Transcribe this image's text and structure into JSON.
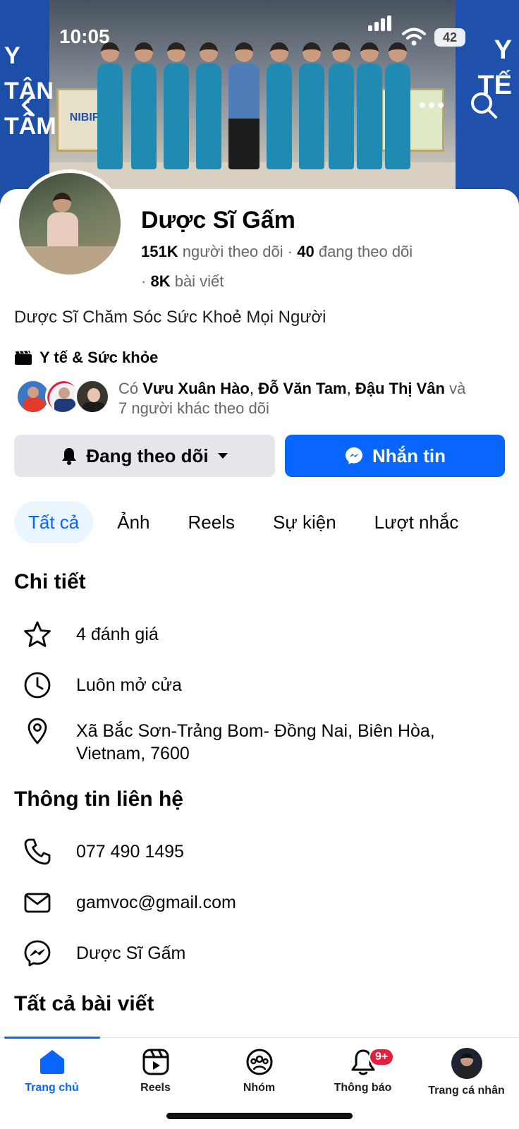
{
  "status_bar": {
    "time": "10:05",
    "battery": "42"
  },
  "cover": {
    "left_sign": [
      "Y",
      "TẬN",
      "TÂM"
    ],
    "right_sign": [
      "Y",
      "TẾ"
    ],
    "shop_sign": "NIBIFA"
  },
  "profile": {
    "name": "Dược Sĩ Gấm",
    "followers_count": "151K",
    "followers_label": "người theo dõi",
    "following_count": "40",
    "following_label": "đang theo dõi",
    "posts_count": "8K",
    "posts_label": "bài viết",
    "bio": "Dược Sĩ Chăm Sóc Sức Khoẻ Mọi Người",
    "category": "Y tế & Sức khỏe",
    "mutual": {
      "prefix": "Có",
      "names": [
        "Vưu Xuân Hào",
        "Đỗ Văn Tam",
        "Đậu Thị Vân"
      ],
      "and": "và",
      "others": "7 người khác theo dõi"
    }
  },
  "actions": {
    "following_label": "Đang theo dõi",
    "message_label": "Nhắn tin"
  },
  "tabs": [
    {
      "label": "Tất cả",
      "active": true
    },
    {
      "label": "Ảnh"
    },
    {
      "label": "Reels"
    },
    {
      "label": "Sự kiện"
    },
    {
      "label": "Lượt nhắc"
    }
  ],
  "details": {
    "title": "Chi tiết",
    "rating": "4 đánh giá",
    "hours": "Luôn mở cửa",
    "address": "Xã Bắc Sơn-Trảng Bom- Đồng Nai, Biên Hòa, Vietnam, 7600"
  },
  "contact": {
    "title": "Thông tin liên hệ",
    "phone": "077 490 1495",
    "email": "gamvoc@gmail.com",
    "messenger": "Dược Sĩ Gấm"
  },
  "posts_title": "Tất cả bài viết",
  "bottom_nav": {
    "home": "Trang chủ",
    "reels": "Reels",
    "groups": "Nhóm",
    "notifications": "Thông báo",
    "notifications_badge": "9+",
    "profile": "Trang cá nhân"
  },
  "colors": {
    "accent": "#0866ff",
    "badge": "#e41e3f",
    "button_gray": "#e4e6eb"
  }
}
